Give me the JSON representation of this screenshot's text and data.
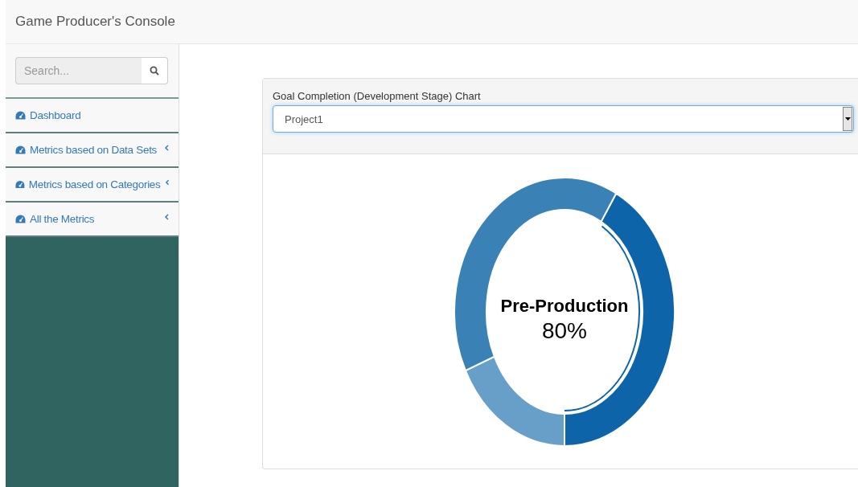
{
  "header": {
    "title": "Game Producer's Console"
  },
  "sidebar": {
    "search": {
      "placeholder": "Search..."
    },
    "items": [
      {
        "label": "Dashboard",
        "expandable": false
      },
      {
        "label": "Metrics based on Data Sets",
        "expandable": true
      },
      {
        "label": "Metrics based on Categories",
        "expandable": true
      },
      {
        "label": "All the Metrics",
        "expandable": true
      }
    ]
  },
  "panel": {
    "label": "Goal Completion (Development Stage) Chart",
    "select": {
      "value": "Project1"
    },
    "donut": {
      "title": "Pre-Production",
      "value": "80%"
    }
  }
}
